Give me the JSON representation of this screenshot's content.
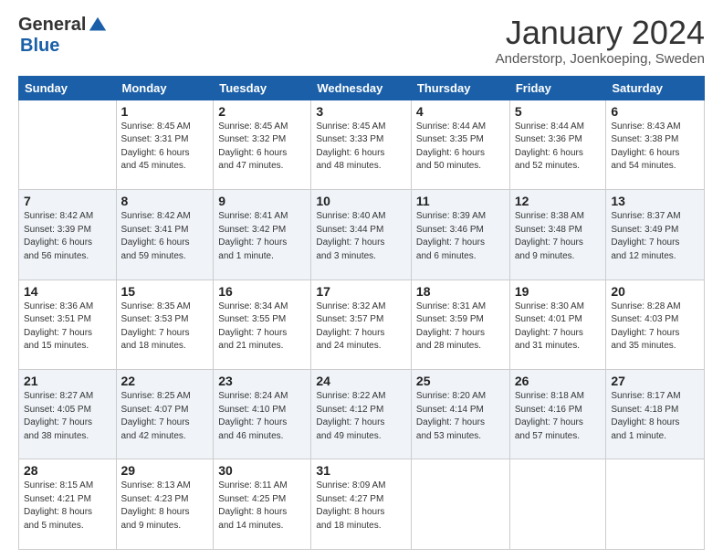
{
  "logo": {
    "general": "General",
    "blue": "Blue"
  },
  "header": {
    "month": "January 2024",
    "location": "Anderstorp, Joenkoeping, Sweden"
  },
  "weekdays": [
    "Sunday",
    "Monday",
    "Tuesday",
    "Wednesday",
    "Thursday",
    "Friday",
    "Saturday"
  ],
  "weeks": [
    [
      {
        "day": "",
        "text": ""
      },
      {
        "day": "1",
        "text": "Sunrise: 8:45 AM\nSunset: 3:31 PM\nDaylight: 6 hours\nand 45 minutes."
      },
      {
        "day": "2",
        "text": "Sunrise: 8:45 AM\nSunset: 3:32 PM\nDaylight: 6 hours\nand 47 minutes."
      },
      {
        "day": "3",
        "text": "Sunrise: 8:45 AM\nSunset: 3:33 PM\nDaylight: 6 hours\nand 48 minutes."
      },
      {
        "day": "4",
        "text": "Sunrise: 8:44 AM\nSunset: 3:35 PM\nDaylight: 6 hours\nand 50 minutes."
      },
      {
        "day": "5",
        "text": "Sunrise: 8:44 AM\nSunset: 3:36 PM\nDaylight: 6 hours\nand 52 minutes."
      },
      {
        "day": "6",
        "text": "Sunrise: 8:43 AM\nSunset: 3:38 PM\nDaylight: 6 hours\nand 54 minutes."
      }
    ],
    [
      {
        "day": "7",
        "text": "Sunrise: 8:42 AM\nSunset: 3:39 PM\nDaylight: 6 hours\nand 56 minutes."
      },
      {
        "day": "8",
        "text": "Sunrise: 8:42 AM\nSunset: 3:41 PM\nDaylight: 6 hours\nand 59 minutes."
      },
      {
        "day": "9",
        "text": "Sunrise: 8:41 AM\nSunset: 3:42 PM\nDaylight: 7 hours\nand 1 minute."
      },
      {
        "day": "10",
        "text": "Sunrise: 8:40 AM\nSunset: 3:44 PM\nDaylight: 7 hours\nand 3 minutes."
      },
      {
        "day": "11",
        "text": "Sunrise: 8:39 AM\nSunset: 3:46 PM\nDaylight: 7 hours\nand 6 minutes."
      },
      {
        "day": "12",
        "text": "Sunrise: 8:38 AM\nSunset: 3:48 PM\nDaylight: 7 hours\nand 9 minutes."
      },
      {
        "day": "13",
        "text": "Sunrise: 8:37 AM\nSunset: 3:49 PM\nDaylight: 7 hours\nand 12 minutes."
      }
    ],
    [
      {
        "day": "14",
        "text": "Sunrise: 8:36 AM\nSunset: 3:51 PM\nDaylight: 7 hours\nand 15 minutes."
      },
      {
        "day": "15",
        "text": "Sunrise: 8:35 AM\nSunset: 3:53 PM\nDaylight: 7 hours\nand 18 minutes."
      },
      {
        "day": "16",
        "text": "Sunrise: 8:34 AM\nSunset: 3:55 PM\nDaylight: 7 hours\nand 21 minutes."
      },
      {
        "day": "17",
        "text": "Sunrise: 8:32 AM\nSunset: 3:57 PM\nDaylight: 7 hours\nand 24 minutes."
      },
      {
        "day": "18",
        "text": "Sunrise: 8:31 AM\nSunset: 3:59 PM\nDaylight: 7 hours\nand 28 minutes."
      },
      {
        "day": "19",
        "text": "Sunrise: 8:30 AM\nSunset: 4:01 PM\nDaylight: 7 hours\nand 31 minutes."
      },
      {
        "day": "20",
        "text": "Sunrise: 8:28 AM\nSunset: 4:03 PM\nDaylight: 7 hours\nand 35 minutes."
      }
    ],
    [
      {
        "day": "21",
        "text": "Sunrise: 8:27 AM\nSunset: 4:05 PM\nDaylight: 7 hours\nand 38 minutes."
      },
      {
        "day": "22",
        "text": "Sunrise: 8:25 AM\nSunset: 4:07 PM\nDaylight: 7 hours\nand 42 minutes."
      },
      {
        "day": "23",
        "text": "Sunrise: 8:24 AM\nSunset: 4:10 PM\nDaylight: 7 hours\nand 46 minutes."
      },
      {
        "day": "24",
        "text": "Sunrise: 8:22 AM\nSunset: 4:12 PM\nDaylight: 7 hours\nand 49 minutes."
      },
      {
        "day": "25",
        "text": "Sunrise: 8:20 AM\nSunset: 4:14 PM\nDaylight: 7 hours\nand 53 minutes."
      },
      {
        "day": "26",
        "text": "Sunrise: 8:18 AM\nSunset: 4:16 PM\nDaylight: 7 hours\nand 57 minutes."
      },
      {
        "day": "27",
        "text": "Sunrise: 8:17 AM\nSunset: 4:18 PM\nDaylight: 8 hours\nand 1 minute."
      }
    ],
    [
      {
        "day": "28",
        "text": "Sunrise: 8:15 AM\nSunset: 4:21 PM\nDaylight: 8 hours\nand 5 minutes."
      },
      {
        "day": "29",
        "text": "Sunrise: 8:13 AM\nSunset: 4:23 PM\nDaylight: 8 hours\nand 9 minutes."
      },
      {
        "day": "30",
        "text": "Sunrise: 8:11 AM\nSunset: 4:25 PM\nDaylight: 8 hours\nand 14 minutes."
      },
      {
        "day": "31",
        "text": "Sunrise: 8:09 AM\nSunset: 4:27 PM\nDaylight: 8 hours\nand 18 minutes."
      },
      {
        "day": "",
        "text": ""
      },
      {
        "day": "",
        "text": ""
      },
      {
        "day": "",
        "text": ""
      }
    ]
  ]
}
